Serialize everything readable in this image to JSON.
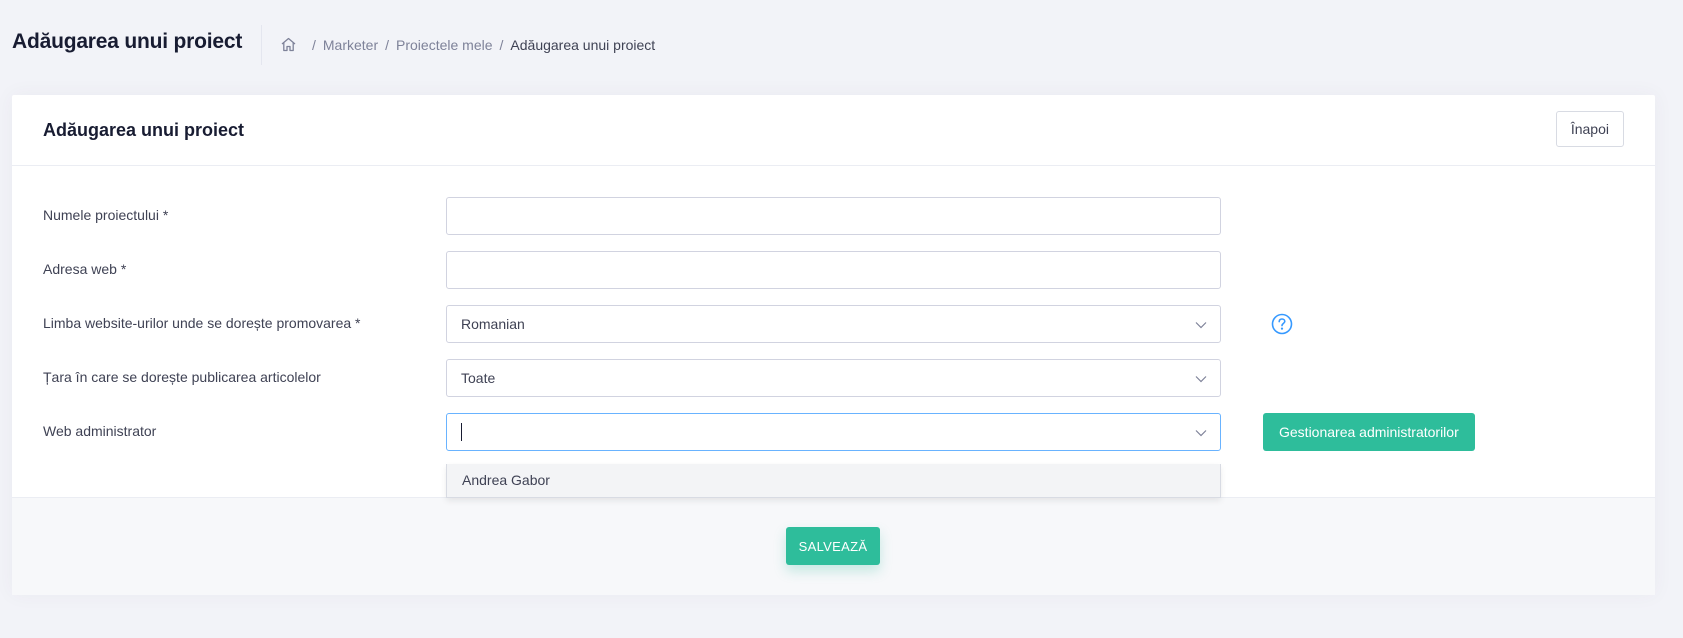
{
  "header": {
    "title": "Adăugarea unui proiect",
    "breadcrumb": {
      "home_icon": "home-icon",
      "items": [
        "Marketer",
        "Proiectele mele",
        "Adăugarea unui proiect"
      ],
      "separator": "/"
    }
  },
  "card": {
    "title": "Adăugarea unui proiect",
    "back_label": "Înapoi"
  },
  "form": {
    "project_name": {
      "label": "Numele proiectului *",
      "value": ""
    },
    "web_address": {
      "label": "Adresa web *",
      "value": ""
    },
    "language": {
      "label": "Limba website-urilor unde se dorește promovarea *",
      "value": "Romanian",
      "help_icon": "question-circle-icon"
    },
    "country": {
      "label": "Țara în care se dorește publicarea articolelor",
      "value": "Toate"
    },
    "web_admin": {
      "label": "Web administrator",
      "value": "",
      "manage_label": "Gestionarea administratorilor",
      "options": [
        "Andrea Gabor"
      ]
    }
  },
  "footer": {
    "save_label": "SALVEAZĂ"
  },
  "colors": {
    "accent": "#2ebd9b",
    "help": "#3699ff",
    "focus_border": "#69b3ff"
  }
}
